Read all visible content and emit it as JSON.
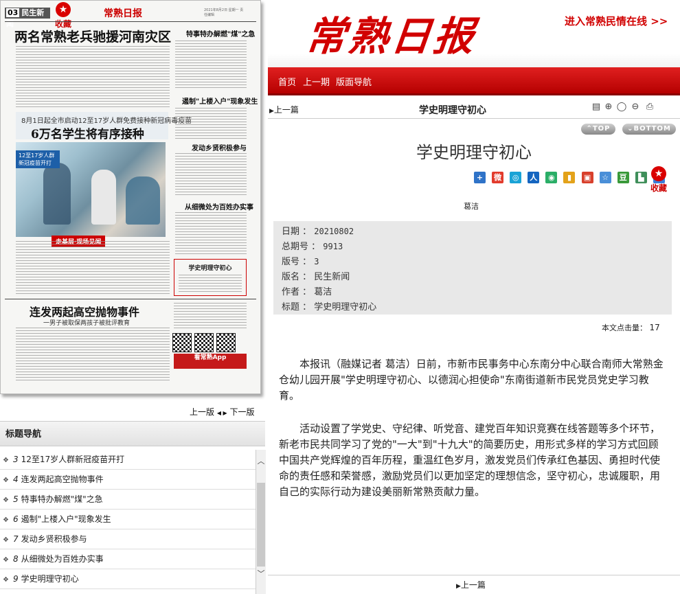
{
  "paper_preview": {
    "page_no": "03",
    "section": "民生新闻",
    "small_logo": "常熟日报",
    "date_line": "2021年8月2日 星期一 责任编辑",
    "fav_label": "收藏",
    "headline1": "两名常熟老兵驰援河南灾区",
    "kicker2": "8月1日起全市启动12至17岁人群免费接种新冠病毒疫苗",
    "headline2": "6万名学生将有序接种",
    "photo_tag": "12至17岁人群新冠疫苗开打",
    "photo_banner": "走基层·现场见闻",
    "right_h1": "特事特办解燃\"煤\"之急",
    "right_h2": "遏制\"上楼入户\"现象发生",
    "right_h3": "发动乡贤积极参与",
    "right_h4": "从细微处为百姓办实事",
    "boxed_title": "学史明理守初心",
    "headline3": "连发两起高空抛物事件",
    "sub3": "一男子被取保两孩子被批评教育",
    "app_bar": "看常熟App"
  },
  "pager": {
    "prev": "上一版",
    "arrows": "◀ ▶",
    "next": "下一版"
  },
  "title_nav": {
    "header": "标题导航",
    "items": [
      {
        "num": "3",
        "label": "12至17岁人群新冠疫苗开打"
      },
      {
        "num": "4",
        "label": "连发两起高空抛物事件"
      },
      {
        "num": "5",
        "label": "特事特办解燃\"煤\"之急"
      },
      {
        "num": "6",
        "label": "遏制\"上楼入户\"现象发生"
      },
      {
        "num": "7",
        "label": "发动乡贤积极参与"
      },
      {
        "num": "8",
        "label": "从细微处为百姓办实事"
      },
      {
        "num": "9",
        "label": "学史明理守初心"
      }
    ]
  },
  "masthead": {
    "logo": "常熟日报",
    "enter_link": "进入常熟民情在线 >>"
  },
  "nav": {
    "home": "首页",
    "prev_issue": "上一期",
    "layout_nav": "版面导航"
  },
  "toolbar": {
    "prev_article": "上一篇",
    "title": "学史明理守初心",
    "top_label": "TOP",
    "bottom_label": "BOTTOM"
  },
  "article": {
    "title": "学史明理守初心",
    "author_line": "葛洁",
    "fav_label": "收藏",
    "meta": [
      {
        "key": "日期 ：",
        "value": "20210802"
      },
      {
        "key": "总期号 ：",
        "value": "9913"
      },
      {
        "key": "版号 ：",
        "value": "3"
      },
      {
        "key": "版名 ：",
        "value": "民生新闻"
      },
      {
        "key": "作者 ：",
        "value": "葛洁"
      },
      {
        "key": "标题 ：",
        "value": "学史明理守初心"
      }
    ],
    "hits_label": "本文点击量：",
    "hits_value": "17",
    "para1": "本报讯（融媒记者 葛洁）日前，市新市民事务中心东南分中心联合南师大常熟金仓幼儿园开展\"学史明理守初心、以德润心担使命\"东南街道新市民党员党史学习教育。",
    "para2": "活动设置了学党史、守纪律、听党音、建党百年知识竞赛在线答题等多个环节，新老市民共同学习了党的\"一大\"到\"十九大\"的简要历史，用形式多样的学习方式回顾中国共产党辉煌的百年历程，重温红色岁月，激发党员们传承红色基因、勇担时代使命的责任感和荣誉感，激励党员们以更加坚定的理想信念，坚守初心，忠诚履职，用自己的实际行动为建设美丽新常熟贡献力量。",
    "prev_bottom": "上一篇"
  },
  "colors": {
    "brand_red": "#d10000",
    "nav_red": "#c00000",
    "meta_bg": "#e8e8e8"
  }
}
